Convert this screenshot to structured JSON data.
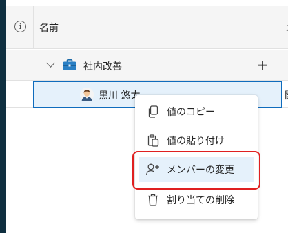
{
  "grid": {
    "header": {
      "info_icon": "info-icon",
      "name_column": "名前",
      "next_column": "メ"
    },
    "group": {
      "label": "社内改善",
      "icon": "briefcase-icon",
      "add_label": "+"
    },
    "person": {
      "name": "黒川 悠太",
      "next_value": "開"
    }
  },
  "context_menu": {
    "items": [
      {
        "label": "値のコピー",
        "icon": "copy-icon"
      },
      {
        "label": "値の貼り付け",
        "icon": "paste-icon"
      },
      {
        "label": "メンバーの変更",
        "icon": "person-add-icon",
        "highlighted": true
      },
      {
        "label": "割り当ての削除",
        "icon": "delete-icon"
      }
    ]
  },
  "colors": {
    "accent": "#0f6cbd",
    "selection_bg": "#e5f1fb",
    "highlight_frame": "#e02020",
    "left_rail": "#0f2f40"
  }
}
